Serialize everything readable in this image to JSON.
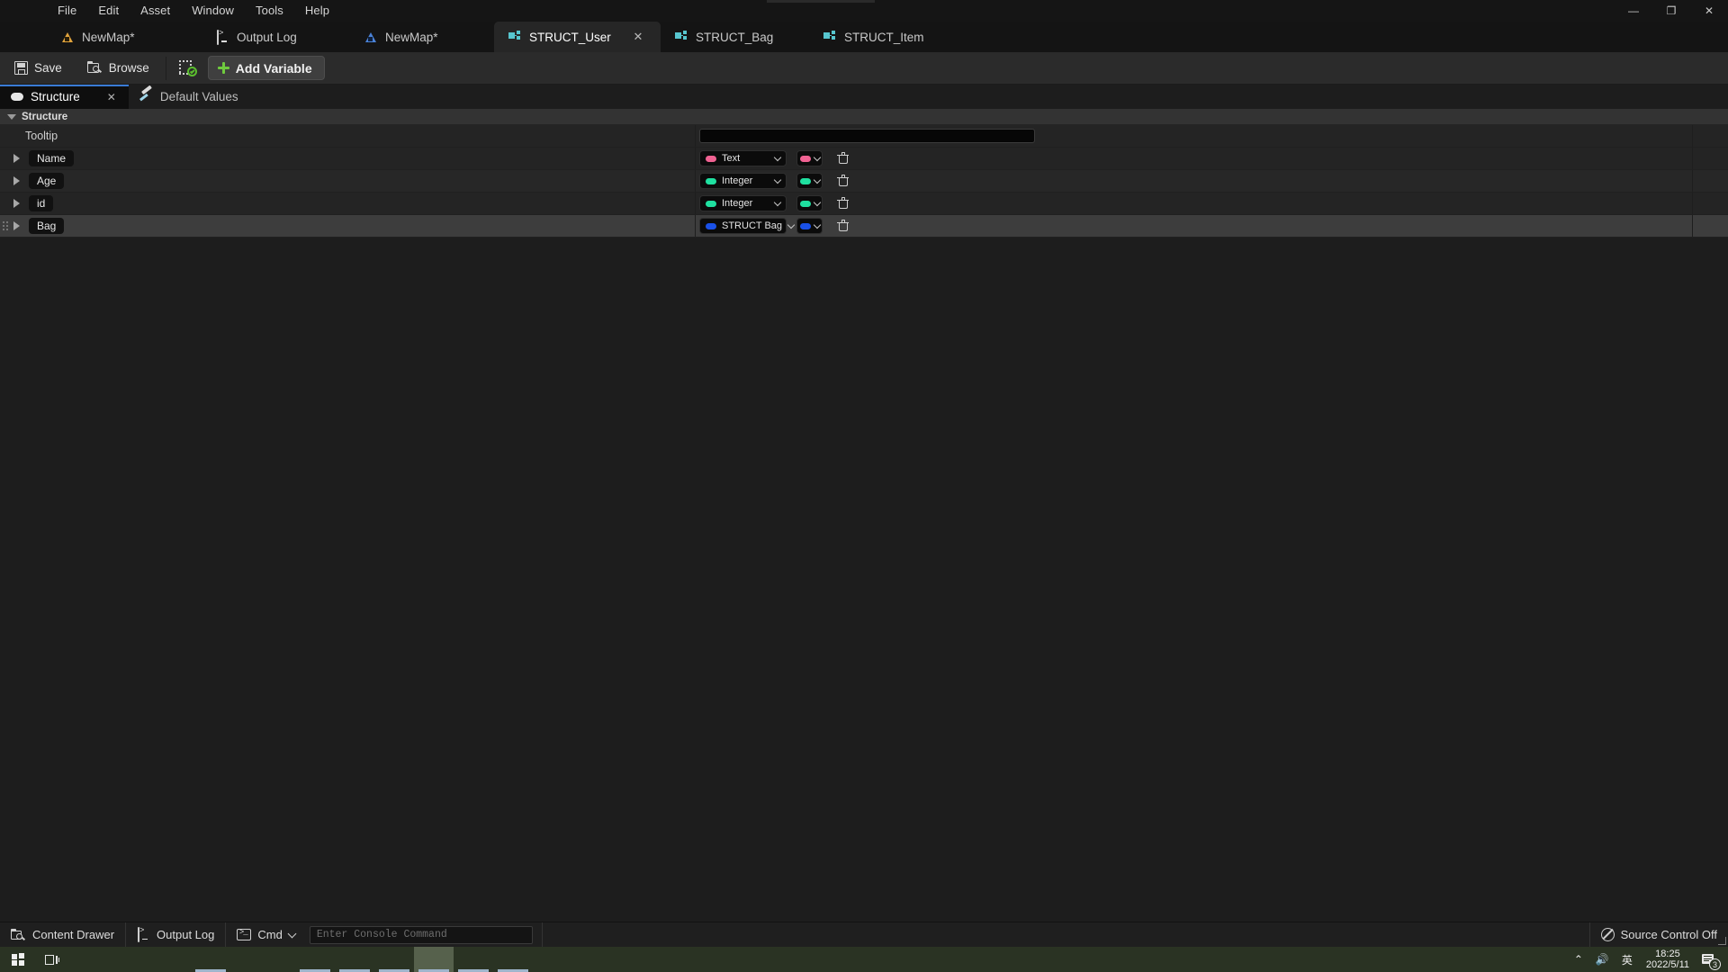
{
  "window": {
    "menu": [
      "File",
      "Edit",
      "Asset",
      "Window",
      "Tools",
      "Help"
    ],
    "controls": {
      "minimize": "—",
      "maximize": "❐",
      "close": "✕"
    }
  },
  "asset_tabs": [
    {
      "label": "NewMap*",
      "icon": "map-orange-icon",
      "active": false,
      "closable": false
    },
    {
      "label": "Output Log",
      "icon": "output-log-icon",
      "active": false,
      "closable": false
    },
    {
      "label": "NewMap*",
      "icon": "map-blue-icon",
      "active": false,
      "closable": false
    },
    {
      "label": "STRUCT_User",
      "icon": "struct-icon",
      "active": true,
      "closable": true,
      "close": "✕"
    },
    {
      "label": "STRUCT_Bag",
      "icon": "struct-icon",
      "active": false,
      "closable": false
    },
    {
      "label": "STRUCT_Item",
      "icon": "struct-icon",
      "active": false,
      "closable": false
    }
  ],
  "toolbar": {
    "save_label": "Save",
    "browse_label": "Browse",
    "add_variable_label": "Add Variable"
  },
  "doc_tabs": [
    {
      "label": "Structure",
      "icon": "pill-icon",
      "active": true,
      "close": "✕"
    },
    {
      "label": "Default Values",
      "icon": "pencil-icon",
      "active": false
    }
  ],
  "category": {
    "title": "Structure"
  },
  "structure": {
    "tooltip_row": {
      "label": "Tooltip",
      "value": "",
      "placeholder": ""
    },
    "variables": [
      {
        "name": "Name",
        "type": "Text",
        "type_color": "#f06292",
        "container_color": "#f06292",
        "selected": false,
        "draggable": false
      },
      {
        "name": "Age",
        "type": "Integer",
        "type_color": "#1fe0a0",
        "container_color": "#1fe0a0",
        "selected": false,
        "draggable": false
      },
      {
        "name": "id",
        "type": "Integer",
        "type_color": "#1fe0a0",
        "container_color": "#1fe0a0",
        "selected": false,
        "draggable": false
      },
      {
        "name": "Bag",
        "type": "STRUCT Bag",
        "type_color": "#1a51e8",
        "container_color": "#1a51e8",
        "selected": true,
        "draggable": true
      }
    ]
  },
  "statusbar": {
    "content_drawer": "Content Drawer",
    "output_log": "Output Log",
    "cmd": "Cmd",
    "console_placeholder": "Enter Console Command",
    "source_control": "Source Control Off"
  },
  "taskbar": {
    "ime": "英",
    "chevron": "⌃",
    "volume": "🔊",
    "time": "18:25",
    "date": "2022/5/11",
    "notification_count": "3"
  },
  "colors": {
    "accent_blue": "#3a7bd5",
    "add_green": "#6fca3e",
    "struct_cyan": "#57c6cf",
    "selection": "#3d3d3d"
  }
}
